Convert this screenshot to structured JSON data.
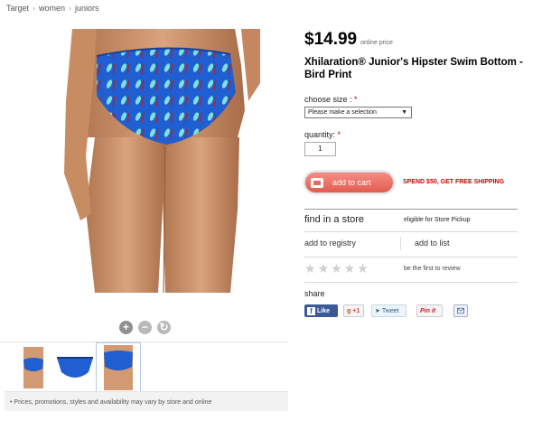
{
  "breadcrumb": [
    "Target",
    "women",
    "juniors"
  ],
  "product": {
    "price": "$14.99",
    "price_note": "online price",
    "title": "Xhilaration® Junior's Hipster Swim Bottom - Bird Print"
  },
  "size": {
    "label": "choose size :",
    "required": "*",
    "selected": "Please make a selection"
  },
  "quantity": {
    "label": "quantity:",
    "required": "*",
    "value": "1"
  },
  "cart": {
    "button_label": "add to cart",
    "promo": "SPEND $50, GET FREE SHIPPING"
  },
  "store": {
    "title": "find in a store",
    "pickup": "eligible for Store Pickup"
  },
  "links": {
    "registry": "add to registry",
    "list": "add to list"
  },
  "reviews": {
    "stars_filled": 0,
    "stars_total": 5,
    "text": "be the first to review"
  },
  "share": {
    "title": "share",
    "facebook": "Like",
    "gplus": "+1",
    "twitter": "Tweet",
    "pinterest": "Pin it"
  },
  "disclaimer": "•  Prices, promotions, styles and availability may vary by store and online",
  "colors": {
    "accent_red": "#cc0000",
    "cart_button": "#e86b60",
    "swim_blue": "#1f5fd1"
  }
}
